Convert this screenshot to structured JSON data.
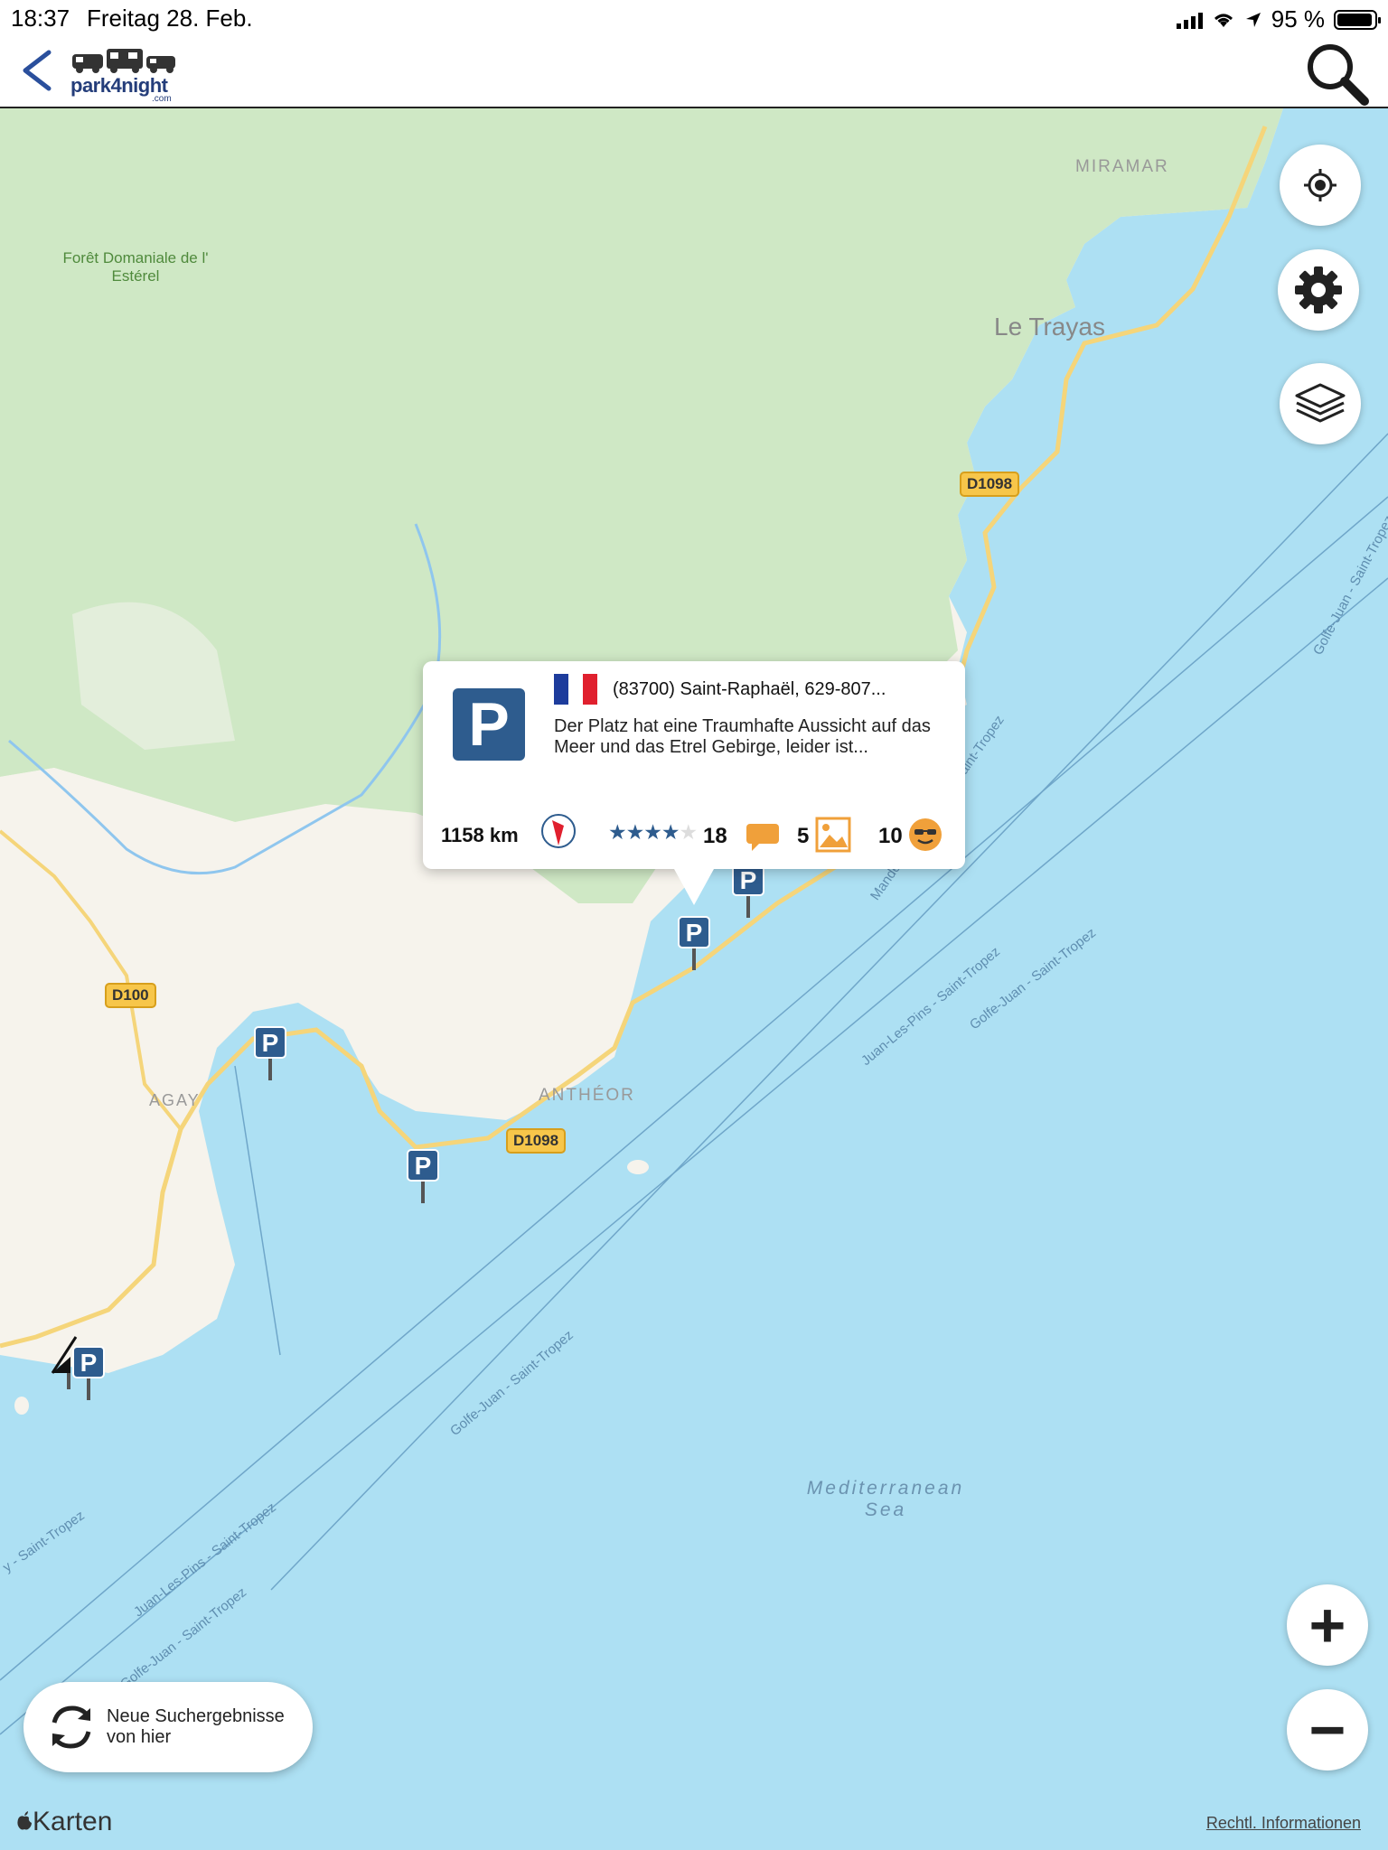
{
  "status_bar": {
    "time": "18:37",
    "date": "Freitag 28. Feb.",
    "battery_text": "95 %",
    "battery_level": 0.95
  },
  "nav": {
    "logo_text": "park4night",
    "logo_suffix": ".com"
  },
  "map": {
    "labels": {
      "forest": "Forêt Domaniale de l' Estérel",
      "miramar": "MIRAMAR",
      "le_trayas": "Le Trayas",
      "agay": "AGAY",
      "antheor": "ANTHÉOR",
      "sea": "Mediterranean Sea",
      "route1": "Mandelieu-la-Napoule - Saint-Tropez",
      "route2": "Juan-Les-Pins - Saint-Tropez",
      "route3": "Golfe-Juan - Saint-Tropez",
      "route4": "Golfe-Juan - Saint-Tropez",
      "route5": "Golfe-Juan - Saint-Tropez",
      "route6": "Juan-Les-Pins - Saint-Tropez",
      "route7": "Golfe-Juan - Saint-Tropez",
      "route8": "y - Saint-Tropez"
    },
    "roads": {
      "d1098_north": "D1098",
      "d100": "D100",
      "d1098_south": "D1098"
    },
    "marker_letter": "P"
  },
  "popup": {
    "address": "(83700) Saint-Raphaël, 629-807...",
    "description": "Der Platz hat eine Traumhafte Aussicht auf das Meer und das Etrel Gebirge, leider ist...",
    "distance": "1158 km",
    "rating": 4,
    "rating_max": 5,
    "comments": "18",
    "photos": "5",
    "score": "10",
    "flag_colors": [
      "#1d3c9c",
      "#ffffff",
      "#e0202e"
    ]
  },
  "buttons": {
    "refresh_label": "Neue Suchergebnisse von hier",
    "zoom_in": "+",
    "zoom_out": "−"
  },
  "footer": {
    "apple_maps": "Karten",
    "legal": "Rechtl. Informationen"
  },
  "colors": {
    "water": "#ade0f3",
    "forest": "#cfe8c5",
    "land": "#f6f3ec",
    "accent_blue": "#2e5c8e",
    "road_yellow": "#f7c64a",
    "orange_icon": "#f0a03a"
  }
}
